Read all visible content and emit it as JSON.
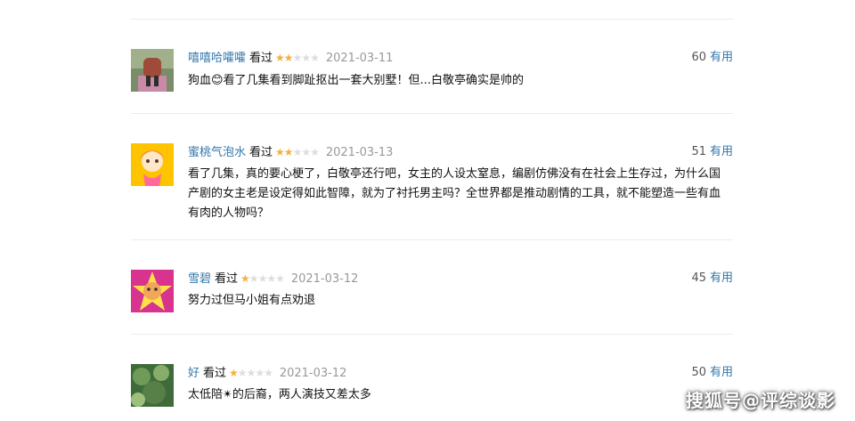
{
  "reviews": [
    {
      "username": "嘻嘻哈嚯嚯",
      "status": "看过",
      "rating": 2,
      "date": "2021-03-11",
      "votes": "60",
      "useful_label": "有用",
      "content": "狗血😊看了几集看到脚趾抠出一套大别墅！但...白敬亭确实是帅的"
    },
    {
      "username": "蜜桃气泡水",
      "status": "看过",
      "rating": 2,
      "date": "2021-03-13",
      "votes": "51",
      "useful_label": "有用",
      "content": "看了几集，真的要心梗了，白敬亭还行吧，女主的人设太窒息，编剧仿佛没有在社会上生存过，为什么国产剧的女主老是设定得如此智障，就为了衬托男主吗？全世界都是推动剧情的工具，就不能塑造一些有血有肉的人物吗？"
    },
    {
      "username": "雪碧",
      "status": "看过",
      "rating": 1,
      "date": "2021-03-12",
      "votes": "45",
      "useful_label": "有用",
      "content": "努力过但马小姐有点劝退"
    },
    {
      "username": "好",
      "status": "看过",
      "rating": 1,
      "date": "2021-03-12",
      "votes": "50",
      "useful_label": "有用",
      "content": "太低陪✴的后裔，两人演技又差太多"
    }
  ],
  "star_icon": "star-icon",
  "colors": {
    "link": "#3377aa",
    "star_filled": "#f4b03d",
    "star_empty": "#dddddd",
    "date": "#999999"
  },
  "watermark": "搜狐号@评综谈影"
}
